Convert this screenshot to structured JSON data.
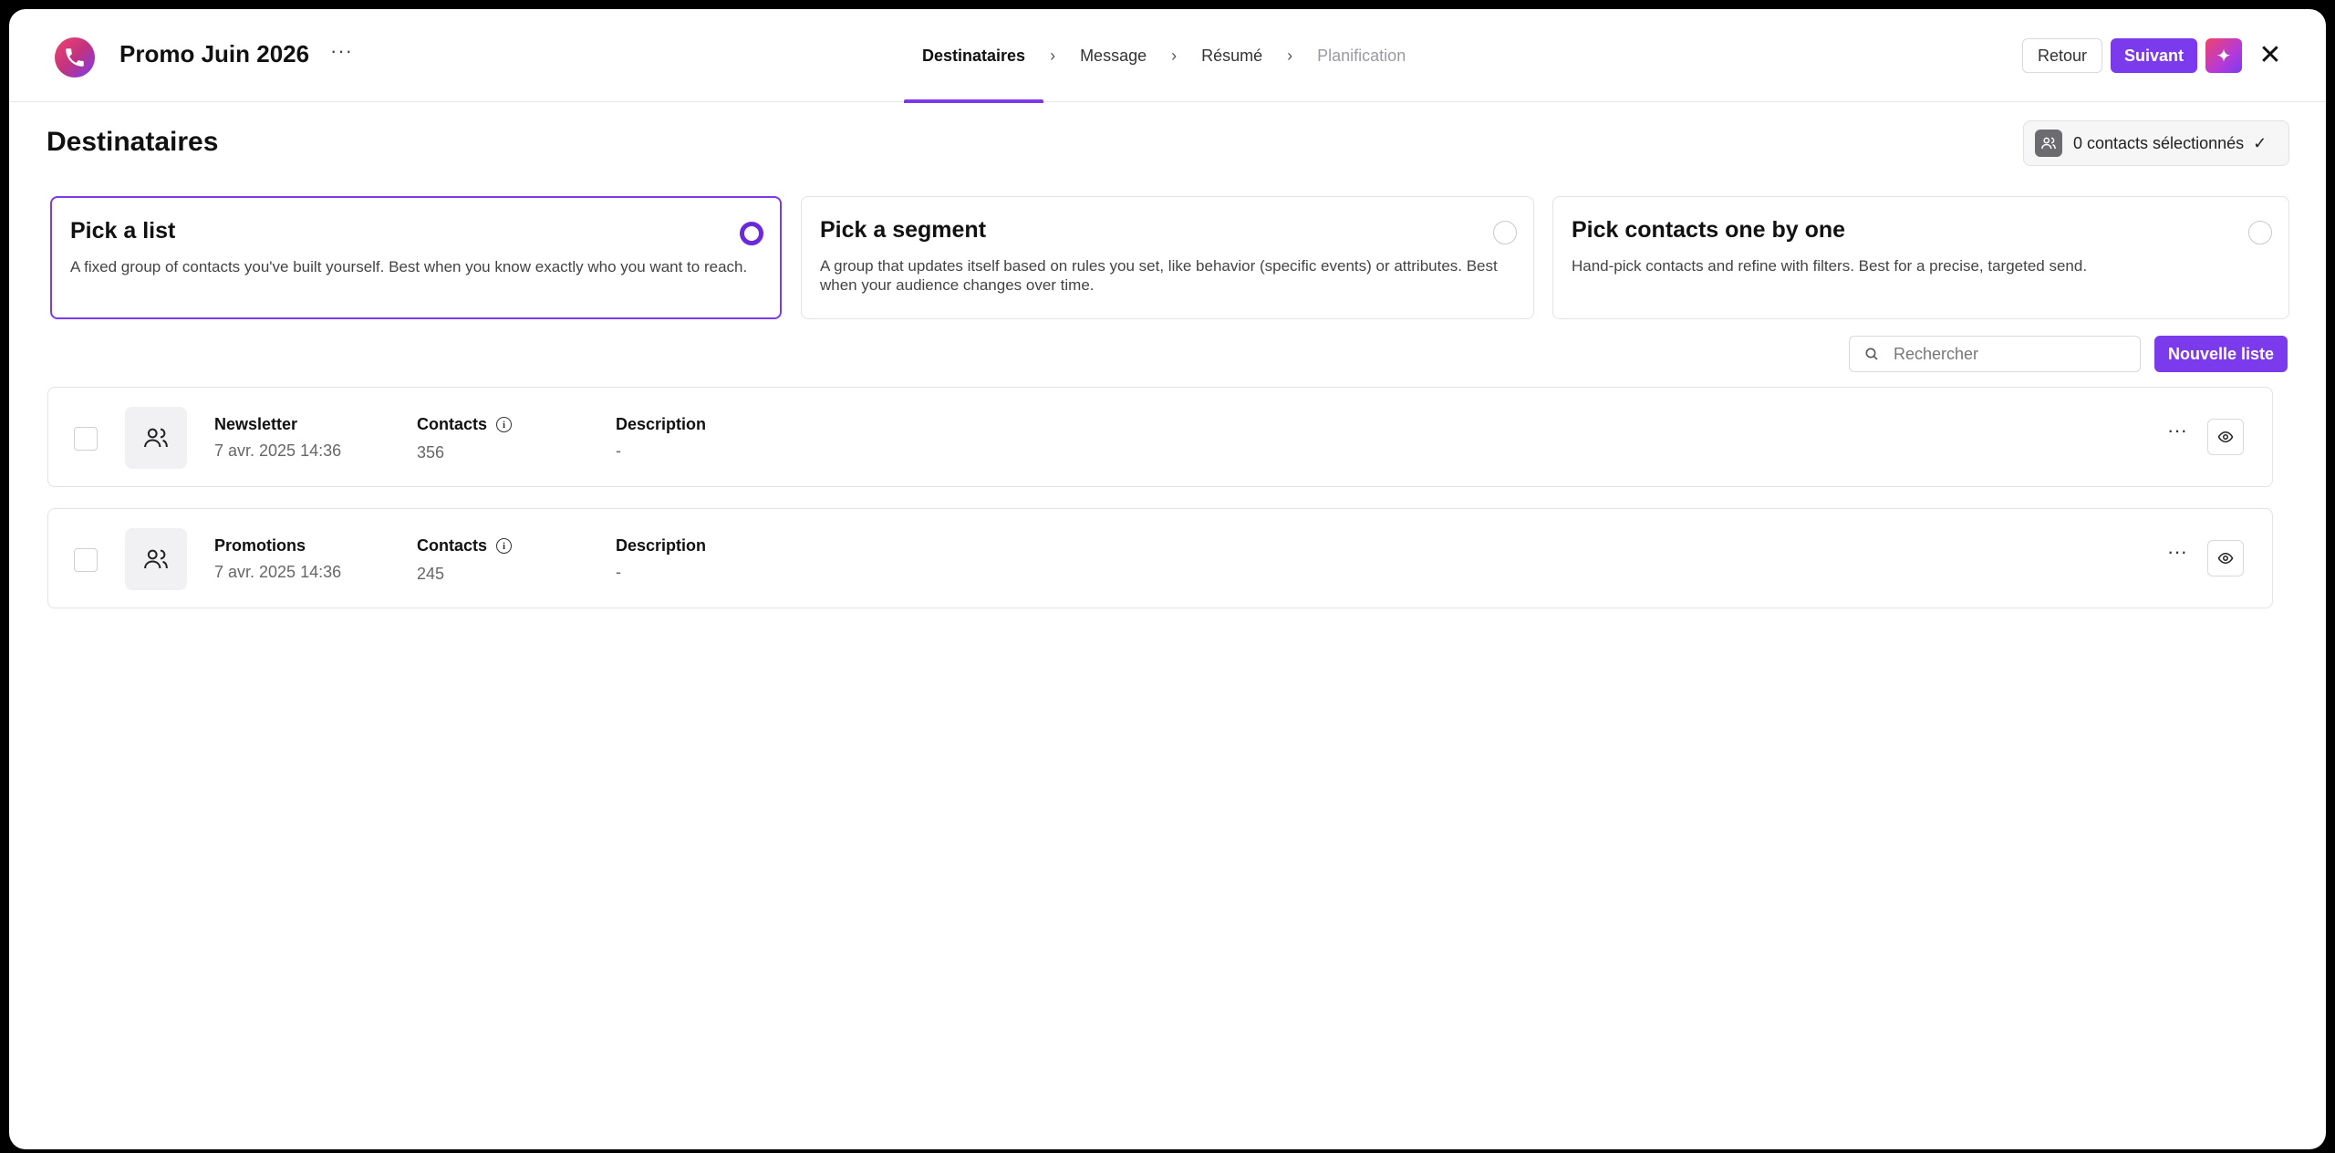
{
  "header": {
    "campaign_title": "Promo Juin 2026",
    "more_label": "···",
    "steps": [
      {
        "label": "Destinataires",
        "state": "active"
      },
      {
        "label": "Message",
        "state": "default"
      },
      {
        "label": "Résumé",
        "state": "default"
      },
      {
        "label": "Planification",
        "state": "disabled"
      }
    ],
    "chevron": "›",
    "back_label": "Retour",
    "next_label": "Suivant",
    "ai_icon": "✦",
    "close_icon": "✕"
  },
  "section": {
    "title": "Destinataires",
    "selected_count_label": "0 contacts sélectionnés",
    "check_icon": "✓"
  },
  "options": [
    {
      "title": "Pick a list",
      "description": "A fixed group of contacts you've built yourself. Best when you know exactly who you want to reach.",
      "selected": true
    },
    {
      "title": "Pick a segment",
      "description": "A group that updates itself based on rules you set, like behavior (specific events) or attributes. Best when your audience changes over time.",
      "selected": false
    },
    {
      "title": "Pick contacts one by one",
      "description": "Hand-pick contacts and refine with filters. Best for a precise, targeted send.",
      "selected": false
    }
  ],
  "toolbar": {
    "search_placeholder": "Rechercher",
    "new_list_label": "Nouvelle liste"
  },
  "lists": [
    {
      "name": "Newsletter",
      "date": "7 avr. 2025 14:36",
      "contacts_label": "Contacts",
      "contacts": "356",
      "description_label": "Description",
      "description": "-"
    },
    {
      "name": "Promotions",
      "date": "7 avr. 2025 14:36",
      "contacts_label": "Contacts",
      "contacts": "245",
      "description_label": "Description",
      "description": "-"
    }
  ],
  "colors": {
    "accent": "#7c3aed",
    "radio_checked": "#6d28d9"
  }
}
